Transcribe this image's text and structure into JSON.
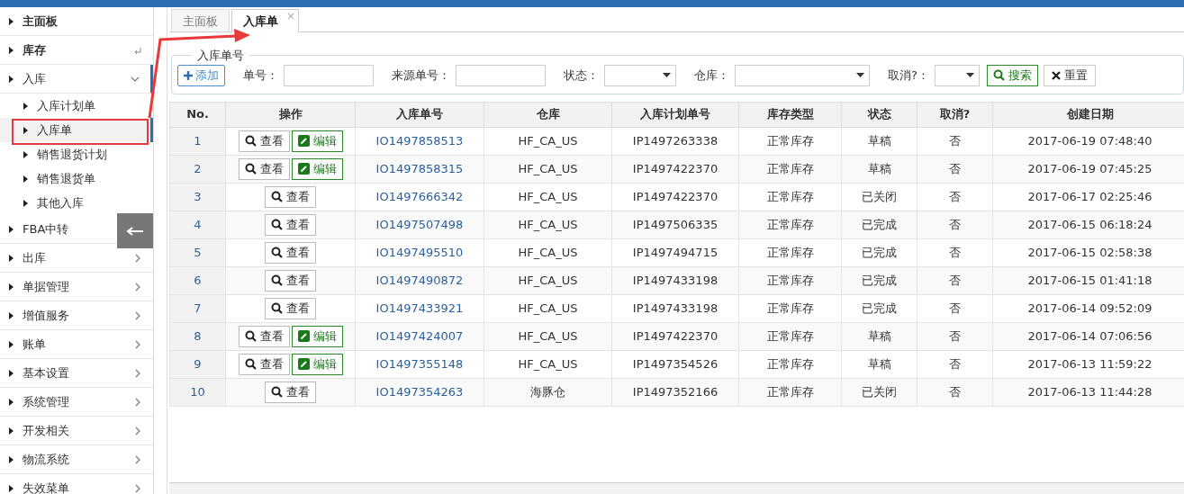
{
  "sidebar": {
    "items": [
      {
        "label": "主面板",
        "kind": "plain",
        "bold": true,
        "expanded": false,
        "selected": false
      },
      {
        "label": "库存",
        "kind": "return",
        "bold": true,
        "expanded": false,
        "selected": false
      },
      {
        "label": "入库",
        "kind": "group",
        "bold": false,
        "expanded": true,
        "selected": true,
        "children": [
          {
            "label": "入库计划单",
            "selected": false
          },
          {
            "label": "入库单",
            "selected": true
          },
          {
            "label": "销售退货计划",
            "selected": false
          },
          {
            "label": "销售退货单",
            "selected": false
          },
          {
            "label": "其他入库",
            "selected": false
          }
        ]
      },
      {
        "label": "FBA中转",
        "kind": "plain",
        "bold": false,
        "expanded": false,
        "selected": false
      },
      {
        "label": "出库",
        "kind": "group",
        "bold": false,
        "expanded": false,
        "selected": false
      },
      {
        "label": "单据管理",
        "kind": "group",
        "bold": false,
        "expanded": false,
        "selected": false
      },
      {
        "label": "增值服务",
        "kind": "group",
        "bold": false,
        "expanded": false,
        "selected": false
      },
      {
        "label": "账单",
        "kind": "group",
        "bold": false,
        "expanded": false,
        "selected": false
      },
      {
        "label": "基本设置",
        "kind": "group",
        "bold": false,
        "expanded": false,
        "selected": false
      },
      {
        "label": "系统管理",
        "kind": "group",
        "bold": false,
        "expanded": false,
        "selected": false
      },
      {
        "label": "开发相关",
        "kind": "group",
        "bold": false,
        "expanded": false,
        "selected": false
      },
      {
        "label": "物流系统",
        "kind": "group",
        "bold": false,
        "expanded": false,
        "selected": false
      },
      {
        "label": "失效菜单",
        "kind": "group",
        "bold": false,
        "expanded": false,
        "selected": false
      }
    ]
  },
  "tabs": [
    {
      "label": "主面板",
      "selected": false,
      "closable": false
    },
    {
      "label": "入库单",
      "selected": true,
      "closable": true,
      "close_label": "×"
    }
  ],
  "filter": {
    "legend": "入库单号",
    "add_button": "添加",
    "fields": [
      {
        "label": "单号：",
        "kind": "text"
      },
      {
        "label": "来源单号：",
        "kind": "text"
      },
      {
        "label": "状态：",
        "kind": "select"
      },
      {
        "label": "仓库：",
        "kind": "select"
      },
      {
        "label": "取消?：",
        "kind": "select"
      }
    ],
    "search_button": "搜索",
    "reset_button": "重置"
  },
  "table": {
    "columns": [
      "No.",
      "操作",
      "入库单号",
      "仓库",
      "入库计划单号",
      "库存类型",
      "状态",
      "取消?",
      "创建日期"
    ],
    "rows": [
      {
        "no": "1",
        "actions": [
          {
            "kind": "view",
            "label": "查看"
          },
          {
            "kind": "edit",
            "label": "编辑"
          }
        ],
        "order_no": "IO1497858513",
        "warehouse": "HF_CA_US",
        "plan_no": "IP1497263338",
        "stock_type": "正常库存",
        "status": "草稿",
        "cancelled": "否",
        "created": "2017-06-19 07:48:40"
      },
      {
        "no": "2",
        "actions": [
          {
            "kind": "view",
            "label": "查看"
          },
          {
            "kind": "edit",
            "label": "编辑"
          }
        ],
        "order_no": "IO1497858315",
        "warehouse": "HF_CA_US",
        "plan_no": "IP1497422370",
        "stock_type": "正常库存",
        "status": "草稿",
        "cancelled": "否",
        "created": "2017-06-19 07:45:25"
      },
      {
        "no": "3",
        "actions": [
          {
            "kind": "view",
            "label": "查看"
          }
        ],
        "order_no": "IO1497666342",
        "warehouse": "HF_CA_US",
        "plan_no": "IP1497422370",
        "stock_type": "正常库存",
        "status": "已关闭",
        "cancelled": "否",
        "created": "2017-06-17 02:25:46"
      },
      {
        "no": "4",
        "actions": [
          {
            "kind": "view",
            "label": "查看"
          }
        ],
        "order_no": "IO1497507498",
        "warehouse": "HF_CA_US",
        "plan_no": "IP1497506335",
        "stock_type": "正常库存",
        "status": "已完成",
        "cancelled": "否",
        "created": "2017-06-15 06:18:24"
      },
      {
        "no": "5",
        "actions": [
          {
            "kind": "view",
            "label": "查看"
          }
        ],
        "order_no": "IO1497495510",
        "warehouse": "HF_CA_US",
        "plan_no": "IP1497494715",
        "stock_type": "正常库存",
        "status": "已完成",
        "cancelled": "否",
        "created": "2017-06-15 02:58:38"
      },
      {
        "no": "6",
        "actions": [
          {
            "kind": "view",
            "label": "查看"
          }
        ],
        "order_no": "IO1497490872",
        "warehouse": "HF_CA_US",
        "plan_no": "IP1497433198",
        "stock_type": "正常库存",
        "status": "已完成",
        "cancelled": "否",
        "created": "2017-06-15 01:41:18"
      },
      {
        "no": "7",
        "actions": [
          {
            "kind": "view",
            "label": "查看"
          }
        ],
        "order_no": "IO1497433921",
        "warehouse": "HF_CA_US",
        "plan_no": "IP1497433198",
        "stock_type": "正常库存",
        "status": "已完成",
        "cancelled": "否",
        "created": "2017-06-14 09:52:09"
      },
      {
        "no": "8",
        "actions": [
          {
            "kind": "view",
            "label": "查看"
          },
          {
            "kind": "edit",
            "label": "编辑"
          }
        ],
        "order_no": "IO1497424007",
        "warehouse": "HF_CA_US",
        "plan_no": "IP1497422370",
        "stock_type": "正常库存",
        "status": "草稿",
        "cancelled": "否",
        "created": "2017-06-14 07:06:56"
      },
      {
        "no": "9",
        "actions": [
          {
            "kind": "view",
            "label": "查看"
          },
          {
            "kind": "edit",
            "label": "编辑"
          }
        ],
        "order_no": "IO1497355148",
        "warehouse": "HF_CA_US",
        "plan_no": "IP1497354526",
        "stock_type": "正常库存",
        "status": "草稿",
        "cancelled": "否",
        "created": "2017-06-13 11:59:22"
      },
      {
        "no": "10",
        "actions": [
          {
            "kind": "view",
            "label": "查看"
          }
        ],
        "order_no": "IO1497354263",
        "warehouse": "海豚仓",
        "plan_no": "IP1497352166",
        "stock_type": "正常库存",
        "status": "已关闭",
        "cancelled": "否",
        "created": "2017-06-13 11:44:28"
      }
    ]
  }
}
